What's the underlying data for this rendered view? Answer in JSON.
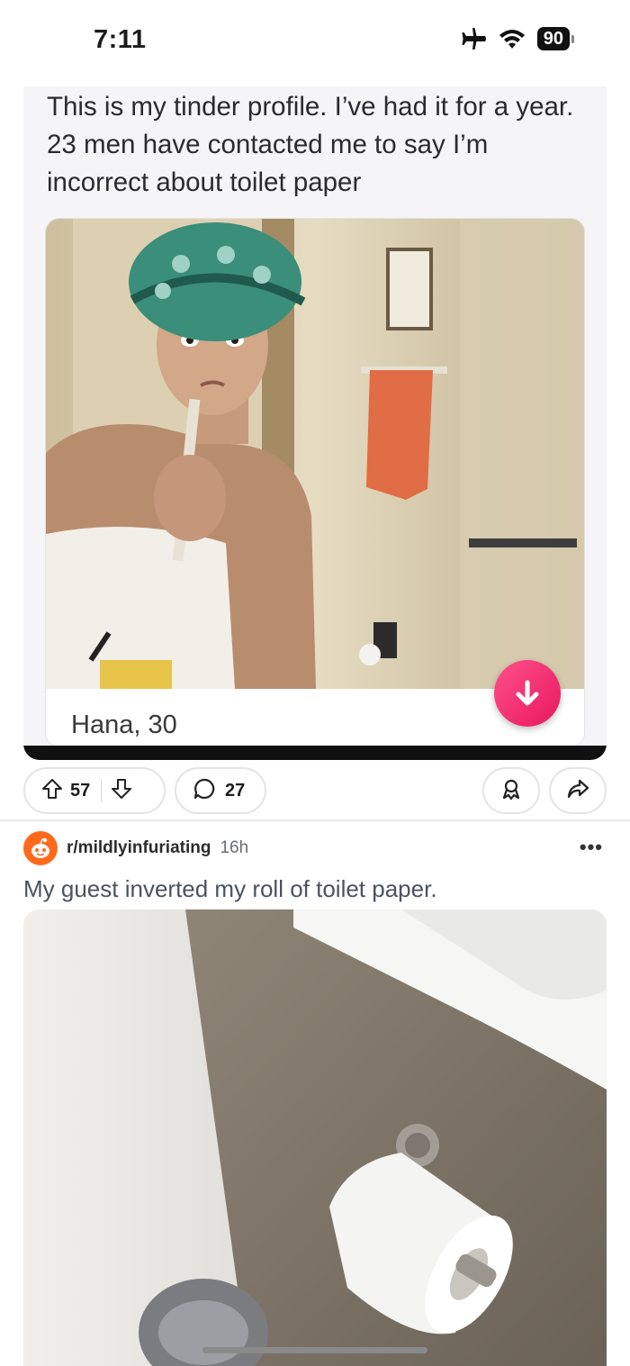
{
  "status_bar": {
    "time": "7:11",
    "battery": "90",
    "airplane_icon": "airplane-icon",
    "wifi_icon": "wifi-icon"
  },
  "post1": {
    "image_caption": "This is my tinder profile. I’ve had it for a year. 23 men have contacted me to say I’m incorrect about toilet paper",
    "profile_name": "Hana, 30",
    "upvotes": "57",
    "comments": "27"
  },
  "post2": {
    "subreddit": "r/mildlyinfuriating",
    "age": "16h",
    "more": "•••",
    "title": "My guest inverted my roll of toilet paper."
  },
  "colors": {
    "tinder_button": "#e8185e",
    "subreddit_avatar": "#ff6a1a",
    "title_text": "#4a5360"
  }
}
